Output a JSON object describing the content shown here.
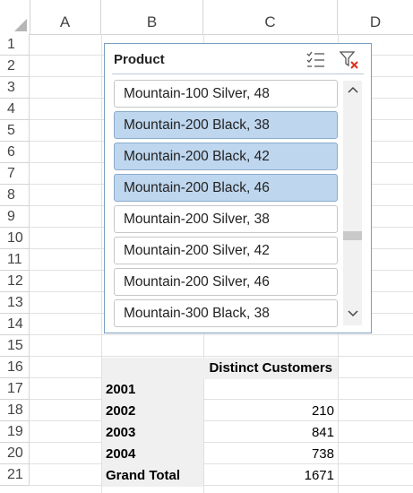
{
  "columns": [
    "A",
    "B",
    "C",
    "D"
  ],
  "rows": [
    "1",
    "2",
    "3",
    "4",
    "5",
    "6",
    "7",
    "8",
    "9",
    "10",
    "11",
    "12",
    "13",
    "14",
    "15",
    "16",
    "17",
    "18",
    "19",
    "20",
    "21"
  ],
  "slicer": {
    "title": "Product",
    "multiselect_icon": "multi-select-icon",
    "clear_filter_icon": "clear-filter-icon",
    "items": [
      {
        "label": "Mountain-100 Silver, 48",
        "selected": false
      },
      {
        "label": "Mountain-200 Black, 38",
        "selected": true
      },
      {
        "label": "Mountain-200 Black, 42",
        "selected": true
      },
      {
        "label": "Mountain-200 Black, 46",
        "selected": true
      },
      {
        "label": "Mountain-200 Silver, 38",
        "selected": false
      },
      {
        "label": "Mountain-200 Silver, 42",
        "selected": false
      },
      {
        "label": "Mountain-200 Silver, 46",
        "selected": false
      },
      {
        "label": "Mountain-300 Black, 38",
        "selected": false
      }
    ],
    "colors": {
      "selected": "#bed6ee",
      "border": "#7b9ec2",
      "clear_x": "#e0301e"
    }
  },
  "pivot": {
    "value_header": "Distinct Customers",
    "rows": [
      {
        "label": "2001",
        "value": ""
      },
      {
        "label": "2002",
        "value": "210"
      },
      {
        "label": "2003",
        "value": "841"
      },
      {
        "label": "2004",
        "value": "738"
      },
      {
        "label": "Grand Total",
        "value": "1671"
      }
    ]
  }
}
